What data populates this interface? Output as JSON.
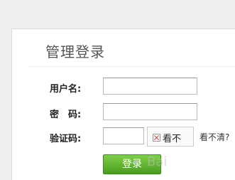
{
  "login_panel": {
    "title": "管理登录",
    "username_label": "用户名:",
    "username_value": "",
    "password_label": "密　码:",
    "password_value": "",
    "captcha_label": "验证码:",
    "captcha_value": "",
    "captcha_image_alt": "看不",
    "refresh_text": "看不清?",
    "login_button": "登录"
  },
  "watermark": "Bai"
}
